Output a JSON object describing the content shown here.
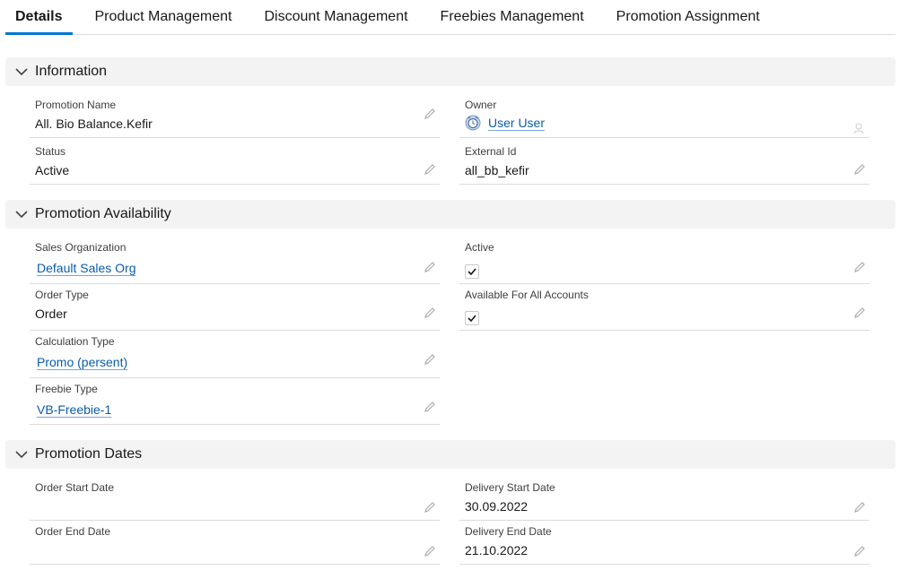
{
  "tabs": [
    {
      "label": "Details",
      "active": true
    },
    {
      "label": "Product Management",
      "active": false
    },
    {
      "label": "Discount Management",
      "active": false
    },
    {
      "label": "Freebies Management",
      "active": false
    },
    {
      "label": "Promotion Assignment",
      "active": false
    }
  ],
  "sections": {
    "information": {
      "title": "Information",
      "promotion_name": {
        "label": "Promotion Name",
        "value": "All. Bio Balance.Kefir"
      },
      "owner": {
        "label": "Owner",
        "value": "User User"
      },
      "status": {
        "label": "Status",
        "value": "Active"
      },
      "external_id": {
        "label": "External Id",
        "value": "all_bb_kefir"
      }
    },
    "availability": {
      "title": "Promotion Availability",
      "sales_org": {
        "label": "Sales Organization",
        "value": "Default Sales Org"
      },
      "active": {
        "label": "Active",
        "checked": true
      },
      "order_type": {
        "label": "Order Type",
        "value": "Order"
      },
      "available_all": {
        "label": "Available For All Accounts",
        "checked": true
      },
      "calculation_type": {
        "label": "Calculation Type",
        "value": "Promo (persent)"
      },
      "freebie_type": {
        "label": "Freebie Type",
        "value": "VB-Freebie-1"
      }
    },
    "dates": {
      "title": "Promotion Dates",
      "order_start": {
        "label": "Order Start Date",
        "value": ""
      },
      "delivery_start": {
        "label": "Delivery Start Date",
        "value": "30.09.2022"
      },
      "order_end": {
        "label": "Order End Date",
        "value": ""
      },
      "delivery_end": {
        "label": "Delivery End Date",
        "value": "21.10.2022"
      }
    }
  },
  "icons": {
    "chevron": "chevron-down-icon",
    "edit": "pencil-icon",
    "owner_change": "change-owner-icon",
    "avatar": "user-avatar-icon",
    "checkbox": "checkmark-icon"
  },
  "colors": {
    "accent": "#0176d3",
    "link": "#0b5cab",
    "section_bg": "#f3f3f3",
    "border": "#dddbda"
  }
}
